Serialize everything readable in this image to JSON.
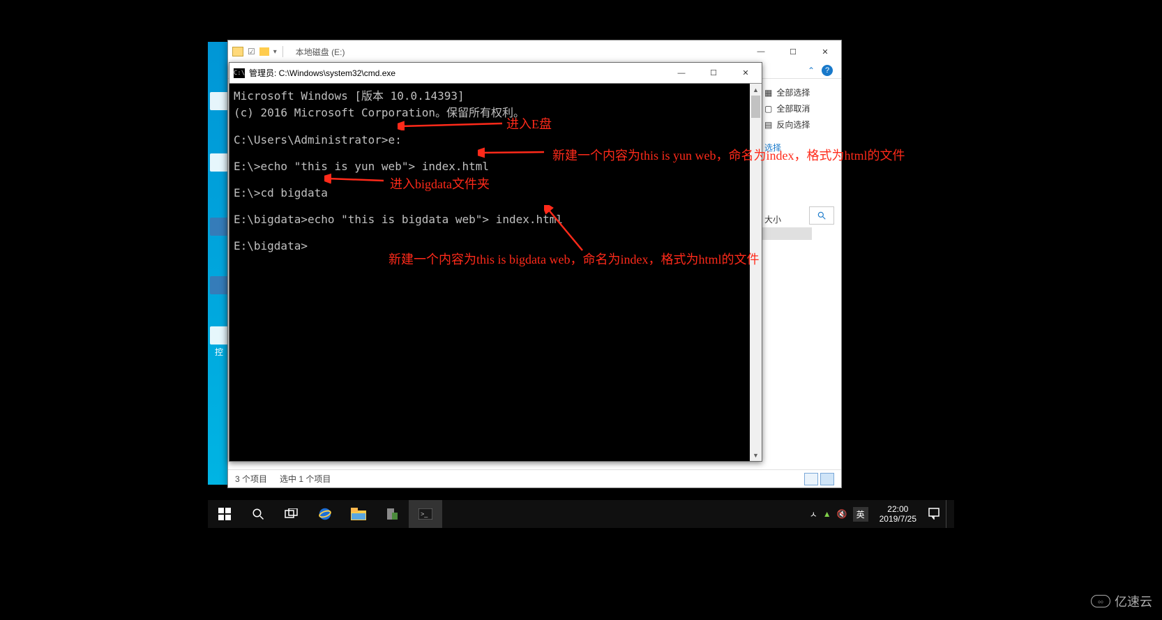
{
  "explorer": {
    "title": "本地磁盘 (E:)",
    "win": {
      "min": "—",
      "max": "☐",
      "close": "✕"
    },
    "side": {
      "select_all": "全部选择",
      "deselect_all": "全部取消",
      "invert": "反向选择",
      "group_sel": "选择",
      "size_hdr": "大小"
    },
    "status": {
      "items": "3 个项目",
      "selected": "选中 1 个项目"
    }
  },
  "cmd": {
    "title": "管理员: C:\\Windows\\system32\\cmd.exe",
    "lines": [
      "Microsoft Windows [版本 10.0.14393]",
      "(c) 2016 Microsoft Corporation。保留所有权利。",
      "",
      "C:\\Users\\Administrator>e:",
      "",
      "E:\\>echo \"this is yun web\"> index.html",
      "",
      "E:\\>cd bigdata",
      "",
      "E:\\bigdata>echo \"this is bigdata web\"> index.html",
      "",
      "E:\\bigdata>"
    ],
    "win": {
      "min": "—",
      "max": "☐",
      "close": "✕"
    }
  },
  "annotations": {
    "a1": "进入E盘",
    "a2": "新建一个内容为this is yun web，命名为index，格式为html的文件",
    "a3": "进入bigdata文件夹",
    "a4": "新建一个内容为this is bigdata web，命名为index，格式为html的文件"
  },
  "taskbar": {
    "time": "22:00",
    "date": "2019/7/25",
    "ime": "英",
    "tray_up": "ㅅ"
  },
  "desktop": {
    "label1": "控"
  },
  "watermark": {
    "text": "亿速云",
    "logo": "ೲ"
  }
}
